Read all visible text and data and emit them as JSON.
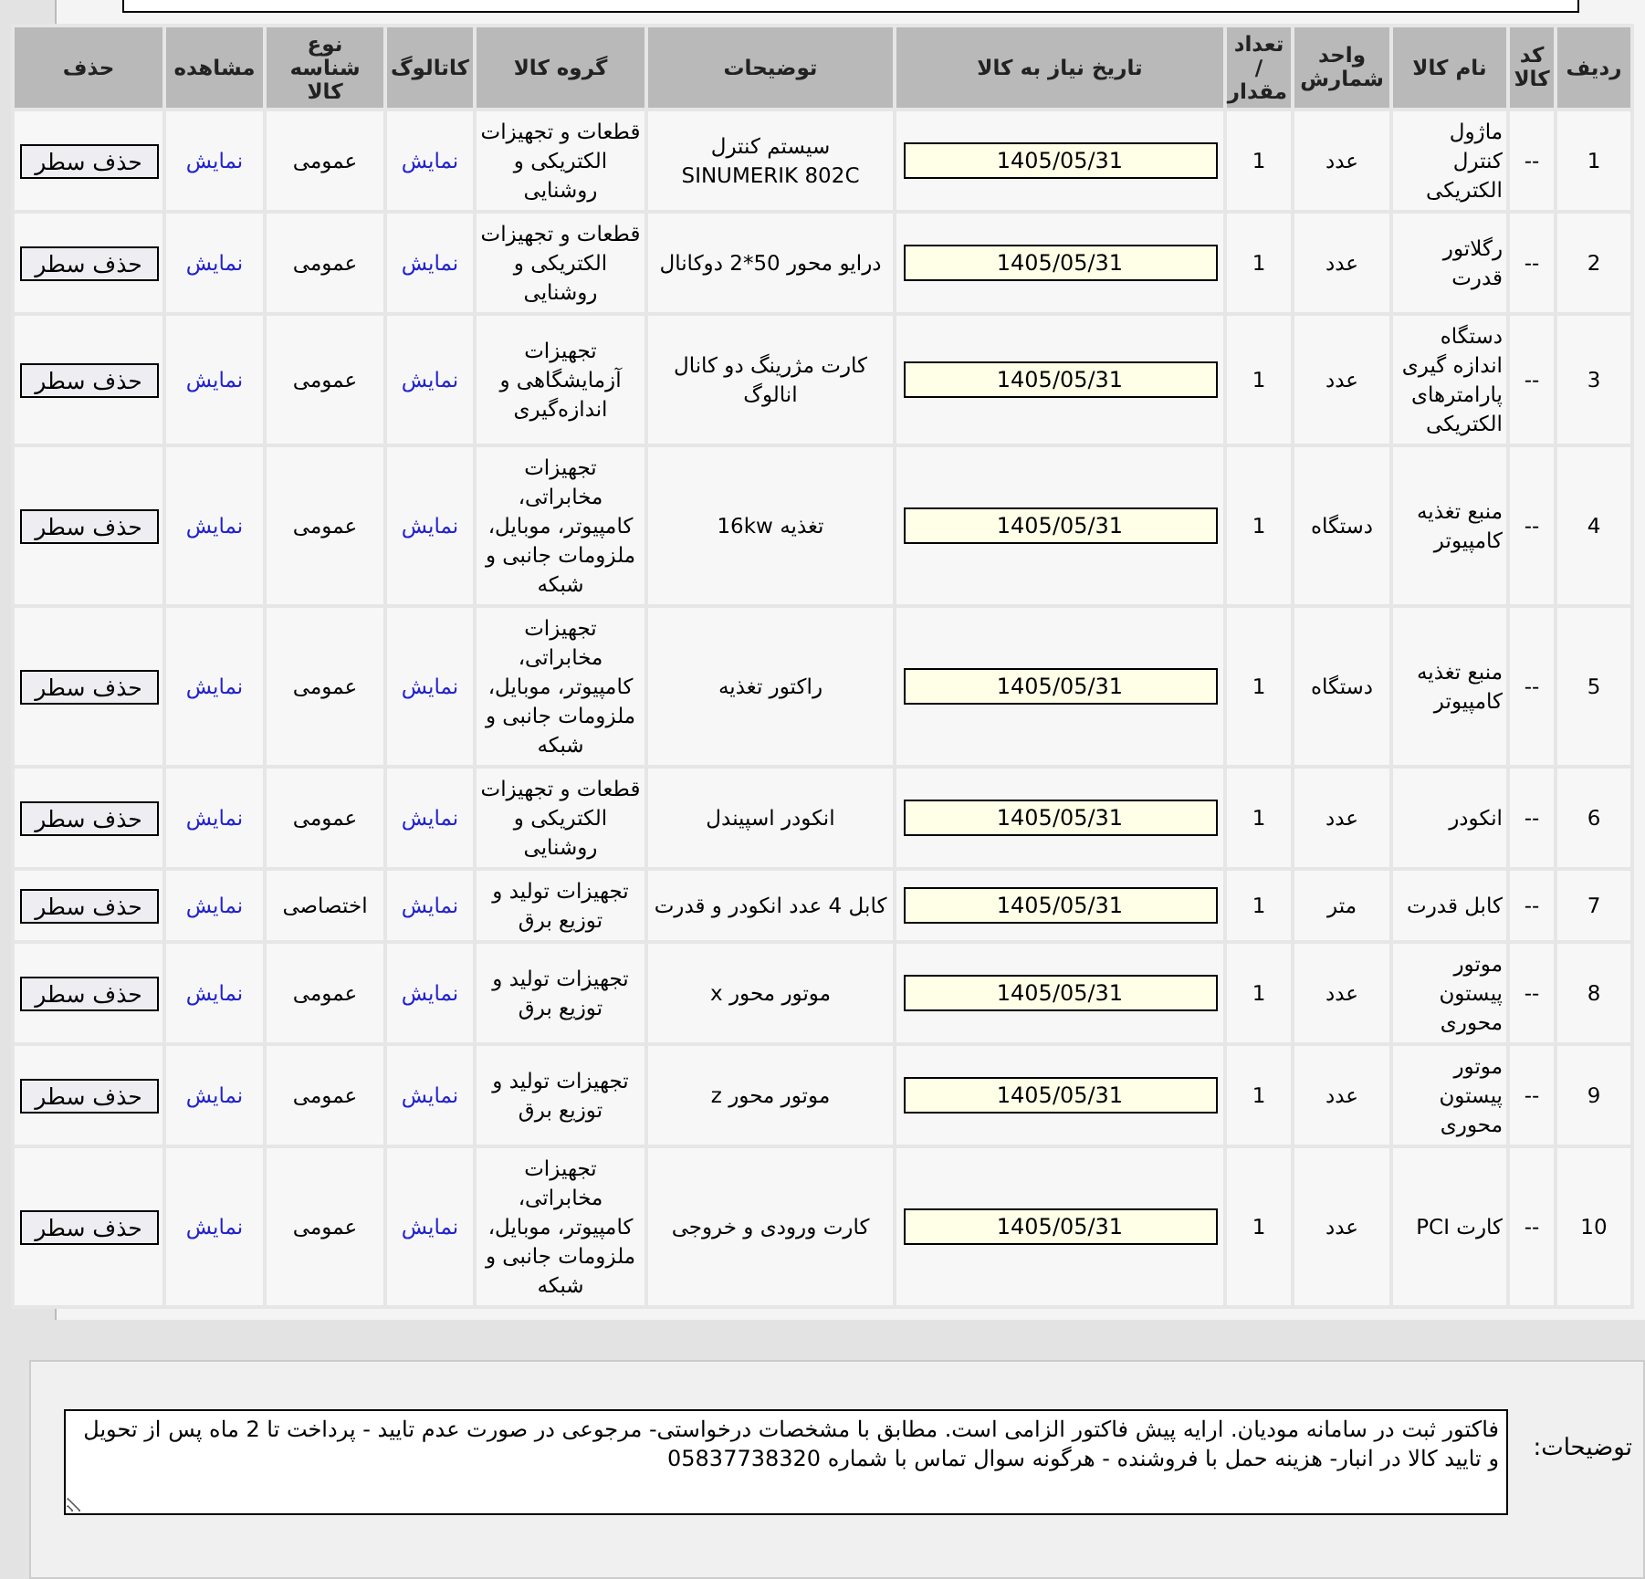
{
  "table": {
    "columns": [
      "ردیف",
      "کد کالا",
      "نام کالا",
      "واحد شمارش",
      "تعداد / مقدار",
      "تاریخ نیاز به کالا",
      "توضیحات",
      "گروه کالا",
      "کاتالوگ",
      "نوع شناسه کالا",
      "مشاهده",
      "حذف"
    ],
    "rows": [
      {
        "row": "1",
        "code": "--",
        "name": "ماژول کنترل الکتریکی",
        "unit": "عدد",
        "qty": "1",
        "date": "1405/05/31",
        "description": "سیستم کنترل SINUMERIK 802C",
        "group": "قطعات و تجهیزات الکتریکی و روشنایی",
        "catalog": "نمایش",
        "id_type": "عمومی",
        "view": "نمایش",
        "delete": "حذف سطر"
      },
      {
        "row": "2",
        "code": "--",
        "name": "رگلاتور قدرت",
        "unit": "عدد",
        "qty": "1",
        "date": "1405/05/31",
        "description": "درایو محور 50*2 دوکانال",
        "group": "قطعات و تجهیزات الکتریکی و روشنایی",
        "catalog": "نمایش",
        "id_type": "عمومی",
        "view": "نمایش",
        "delete": "حذف سطر"
      },
      {
        "row": "3",
        "code": "--",
        "name": "دستگاه اندازه گیری پارامترهای الکتریکی",
        "unit": "عدد",
        "qty": "1",
        "date": "1405/05/31",
        "description": "کارت مژرینگ دو کانال انالوگ",
        "group": "تجهیزات آزمایشگاهی و اندازه‌گیری",
        "catalog": "نمایش",
        "id_type": "عمومی",
        "view": "نمایش",
        "delete": "حذف سطر"
      },
      {
        "row": "4",
        "code": "--",
        "name": "منبع تغذیه کامپیوتر",
        "unit": "دستگاه",
        "qty": "1",
        "date": "1405/05/31",
        "description": "تغذیه 16kw",
        "group": "تجهیزات مخابراتی، کامپیوتر، موبایل، ملزومات جانبی و شبکه",
        "catalog": "نمایش",
        "id_type": "عمومی",
        "view": "نمایش",
        "delete": "حذف سطر"
      },
      {
        "row": "5",
        "code": "--",
        "name": "منبع تغذیه کامپیوتر",
        "unit": "دستگاه",
        "qty": "1",
        "date": "1405/05/31",
        "description": "راکتور تغذیه",
        "group": "تجهیزات مخابراتی، کامپیوتر، موبایل، ملزومات جانبی و شبکه",
        "catalog": "نمایش",
        "id_type": "عمومی",
        "view": "نمایش",
        "delete": "حذف سطر"
      },
      {
        "row": "6",
        "code": "--",
        "name": "انکودر",
        "unit": "عدد",
        "qty": "1",
        "date": "1405/05/31",
        "description": "انکودر اسپیندل",
        "group": "قطعات و تجهیزات الکتریکی و روشنایی",
        "catalog": "نمایش",
        "id_type": "عمومی",
        "view": "نمایش",
        "delete": "حذف سطر"
      },
      {
        "row": "7",
        "code": "--",
        "name": "کابل قدرت",
        "unit": "متر",
        "qty": "1",
        "date": "1405/05/31",
        "description": "کابل 4 عدد انکودر و قدرت",
        "group": "تجهیزات تولید و توزیع برق",
        "catalog": "نمایش",
        "id_type": "اختصاصی",
        "view": "نمایش",
        "delete": "حذف سطر"
      },
      {
        "row": "8",
        "code": "--",
        "name": "موتور پیستون محوری",
        "unit": "عدد",
        "qty": "1",
        "date": "1405/05/31",
        "description": "موتور محور x",
        "group": "تجهیزات تولید و توزیع برق",
        "catalog": "نمایش",
        "id_type": "عمومی",
        "view": "نمایش",
        "delete": "حذف سطر"
      },
      {
        "row": "9",
        "code": "--",
        "name": "موتور پیستون محوری",
        "unit": "عدد",
        "qty": "1",
        "date": "1405/05/31",
        "description": "موتور محور z",
        "group": "تجهیزات تولید و توزیع برق",
        "catalog": "نمایش",
        "id_type": "عمومی",
        "view": "نمایش",
        "delete": "حذف سطر"
      },
      {
        "row": "10",
        "code": "--",
        "name": "کارت PCI",
        "unit": "عدد",
        "qty": "1",
        "date": "1405/05/31",
        "description": "کارت ورودی و خروجی",
        "group": "تجهیزات مخابراتی، کامپیوتر، موبایل، ملزومات جانبی و شبکه",
        "catalog": "نمایش",
        "id_type": "عمومی",
        "view": "نمایش",
        "delete": "حذف سطر"
      }
    ]
  },
  "notes": {
    "label": "توضیحات:",
    "text": "فاکتور ثبت در سامانه مودیان. ارایه پیش فاکتور الزامی است. مطابق با مشخصات درخواستی- مرجوعی در صورت عدم تایید - پرداخت تا 2 ماه پس از تحویل و تایید کالا در انبار- هزینه حمل با فروشنده - هرگونه سوال تماس با شماره 05837738320"
  }
}
